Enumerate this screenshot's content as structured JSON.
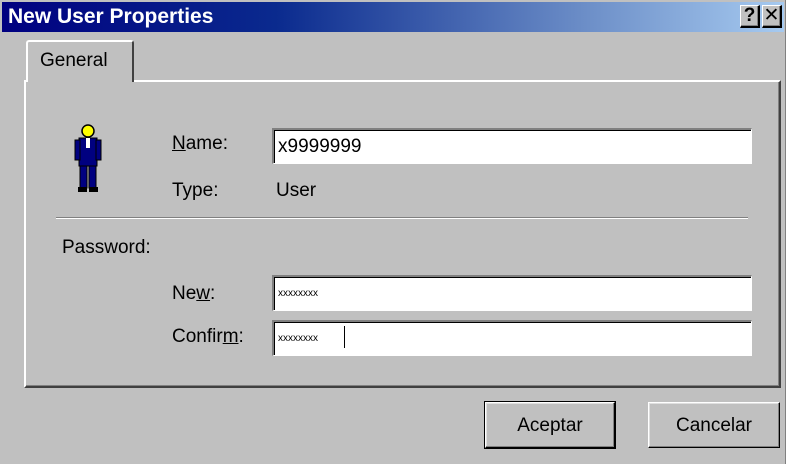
{
  "window": {
    "title": "New User Properties",
    "help_glyph": "?",
    "close_glyph": "✕"
  },
  "tabs": [
    {
      "label": "General",
      "selected": true
    }
  ],
  "general": {
    "icon": "user-icon",
    "name_label_access": "N",
    "name_label_rest": "ame:",
    "name_value": "x9999999",
    "type_label": "Type:",
    "type_value": "User",
    "password_section_label": "Password:",
    "new_label_pre": "Ne",
    "new_label_access": "w",
    "new_label_post": ":",
    "new_value": "xxxxxxxx",
    "confirm_label_pre": "Confir",
    "confirm_label_access": "m",
    "confirm_label_post": ":",
    "confirm_value": "xxxxxxxx"
  },
  "buttons": {
    "ok_label": "Aceptar",
    "cancel_label": "Cancelar"
  },
  "colors": {
    "titlebar_start": "#000080",
    "titlebar_end": "#a6caf0",
    "face": "#c0c0c0"
  }
}
